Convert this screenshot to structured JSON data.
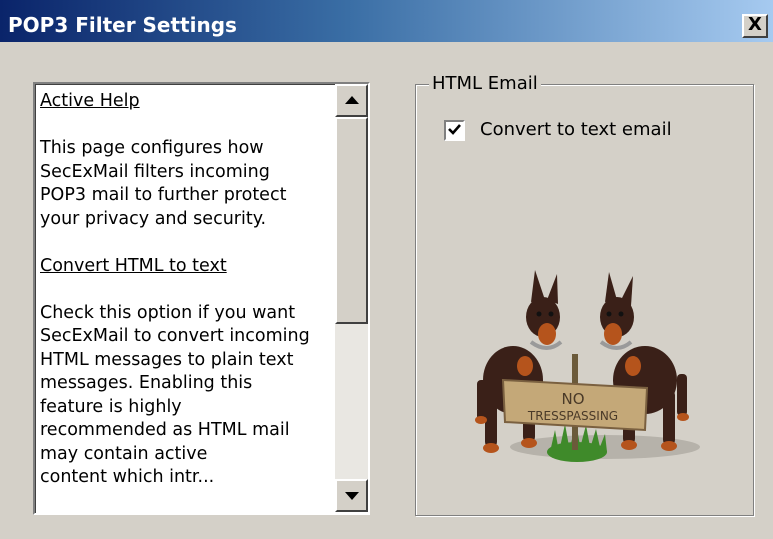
{
  "window": {
    "title": "POP3 Filter Settings",
    "close_label": "X",
    "colors": {
      "titlebar_start": "#0a246a",
      "titlebar_end": "#a6caf0",
      "face": "#d4d0c8"
    }
  },
  "help": {
    "heading1": "Active Help",
    "para1_lines": [
      "This page configures how",
      "SecExMail filters incoming",
      "POP3 mail to further protect",
      "your privacy and security."
    ],
    "heading2": "Convert HTML to text",
    "para2_lines": [
      "Check this option if you want",
      "SecExMail to convert incoming",
      "HTML messages to plain text",
      "messages. Enabling this",
      "feature is highly",
      "recommended as HTML mail",
      "may contain active",
      "content which intr..."
    ],
    "scroll_up_icon": "arrow-up-icon",
    "scroll_down_icon": "arrow-down-icon"
  },
  "html_email": {
    "group_label": "HTML Email",
    "convert_label": "Convert to text email",
    "convert_checked": true,
    "image": "doberman-dogs-no-trespassing-sign"
  },
  "sign": {
    "line1": "NO",
    "line2": "TRESSPASSING"
  }
}
